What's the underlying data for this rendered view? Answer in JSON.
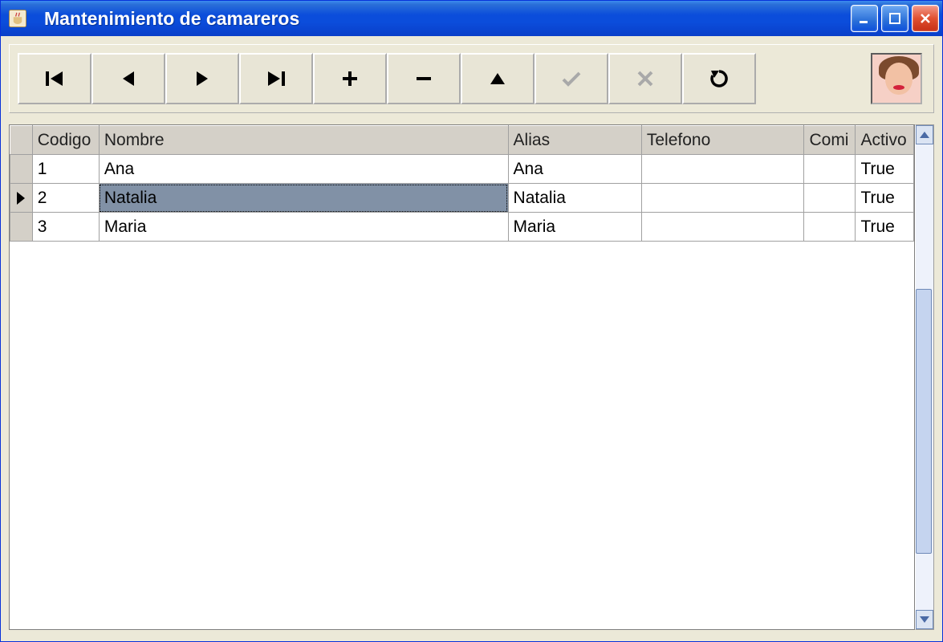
{
  "window": {
    "title": "Mantenimiento de camareros"
  },
  "toolbar": {
    "buttons": {
      "first": "first-record",
      "prev": "previous-record",
      "next": "next-record",
      "last": "last-record",
      "add": "add-record",
      "remove": "remove-record",
      "edit": "edit-record",
      "post": "post-record",
      "cancel": "cancel-record",
      "refresh": "refresh-records"
    }
  },
  "grid": {
    "columns": {
      "codigo": "Codigo",
      "nombre": "Nombre",
      "alias": "Alias",
      "telefono": "Telefono",
      "comi": "Comi",
      "activo": "Activo"
    },
    "rows": [
      {
        "codigo": "1",
        "nombre": "Ana",
        "alias": "Ana",
        "telefono": "",
        "comi": "",
        "activo": "True",
        "current": false
      },
      {
        "codigo": "2",
        "nombre": "Natalia",
        "alias": "Natalia",
        "telefono": "",
        "comi": "",
        "activo": "True",
        "current": true
      },
      {
        "codigo": "3",
        "nombre": "Maria",
        "alias": "Maria",
        "telefono": "",
        "comi": "",
        "activo": "True",
        "current": false
      }
    ],
    "selected_column": "nombre"
  }
}
